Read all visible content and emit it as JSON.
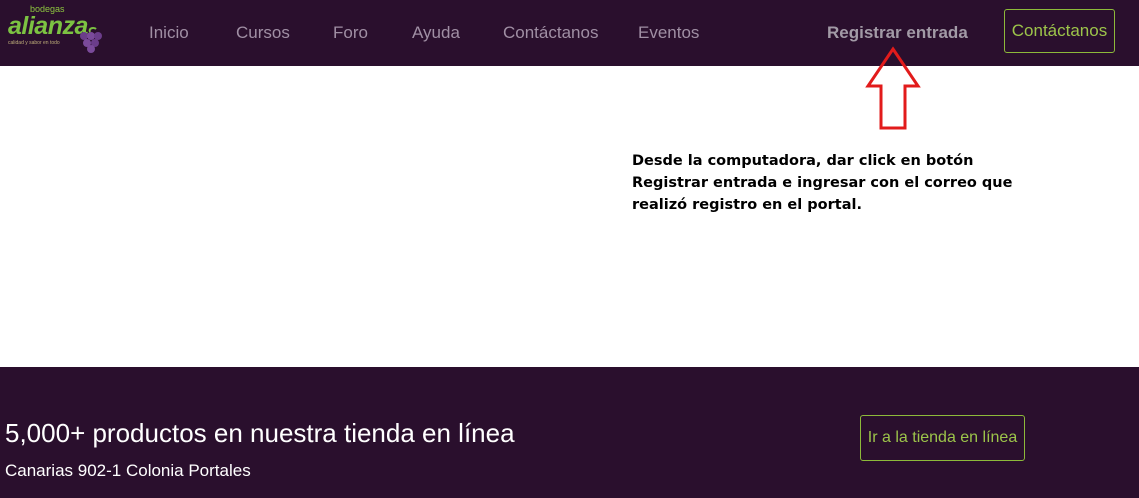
{
  "header": {
    "logo": {
      "tag": "bodegas",
      "word": "alianza",
      "sub": "calidad y sabor en todo"
    },
    "nav": [
      {
        "label": "Inicio"
      },
      {
        "label": "Cursos"
      },
      {
        "label": "Foro"
      },
      {
        "label": "Ayuda"
      },
      {
        "label": "Contáctanos"
      },
      {
        "label": "Eventos"
      }
    ],
    "register_label": "Registrar entrada",
    "contact_button_label": "Contáctanos"
  },
  "annotation": {
    "text": "Desde la computadora, dar click en botón Registrar entrada e ingresar con el correo que realizó registro en el portal.",
    "arrow_color": "#e21b1b"
  },
  "footer": {
    "title": "5,000+ productos en nuestra tienda en línea",
    "address": "Canarias 902-1 Colonia Portales",
    "store_button_label": "Ir a la tienda en línea"
  },
  "colors": {
    "brand_dark": "#2a0f2d",
    "accent_green": "#8db93a",
    "nav_text": "#a08fa4"
  }
}
